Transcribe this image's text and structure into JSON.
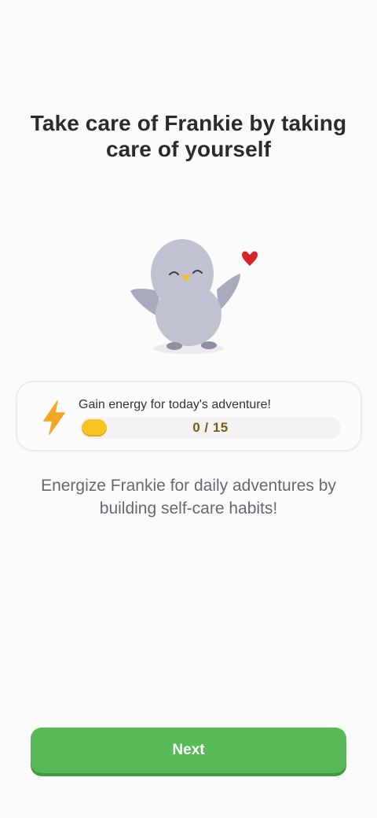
{
  "onboarding": {
    "title": "Take care of Frankie by taking care of yourself",
    "mascot_name": "Frankie",
    "energy": {
      "label": "Gain energy for today's adventure!",
      "current": 0,
      "goal": 15,
      "progress_text": "0 / 15",
      "icon": "lightning-bolt-icon"
    },
    "subtitle": "Energize Frankie for daily adventures by building self-care habits!",
    "next_label": "Next"
  },
  "colors": {
    "primary_button": "#58b957",
    "energy_fill": "#f6c421",
    "bolt": "#f5a623",
    "heart": "#d9232a",
    "mascot_body": "#c0c2d2"
  }
}
